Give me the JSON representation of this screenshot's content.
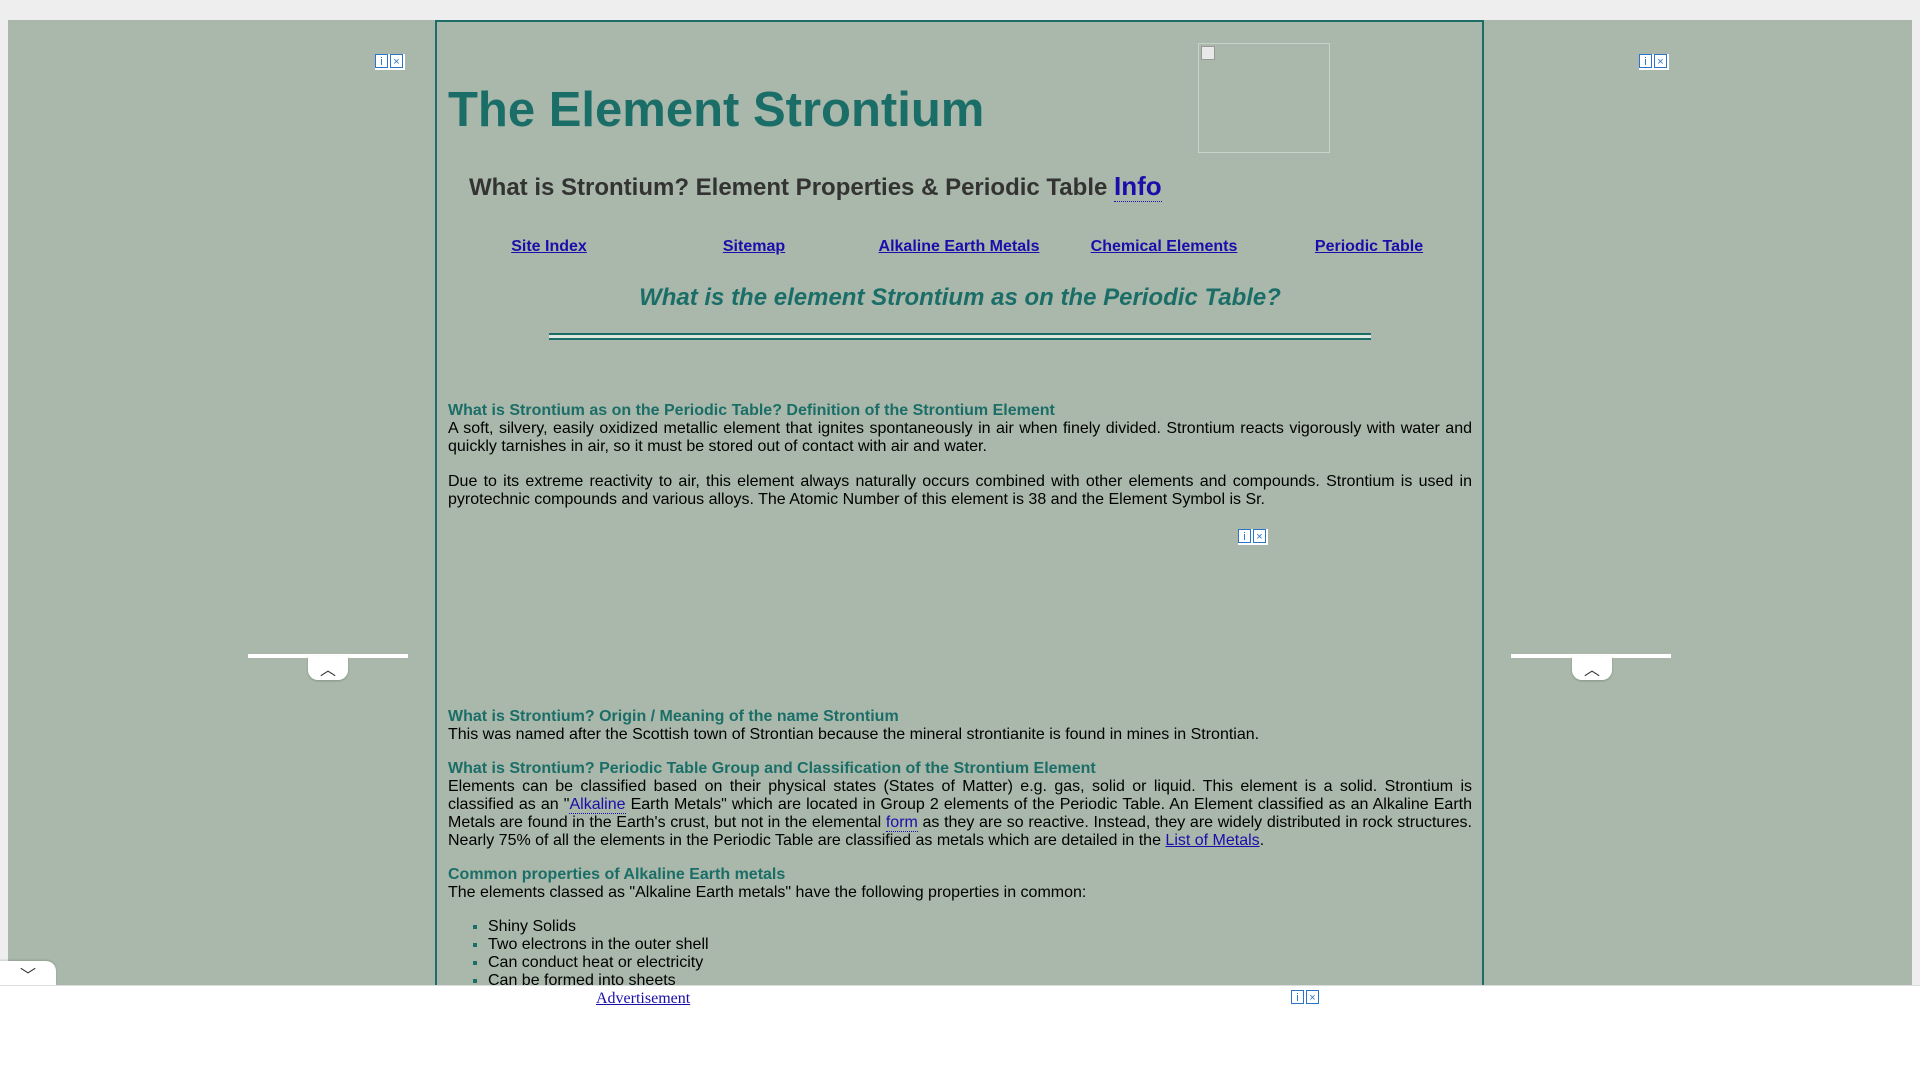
{
  "page": {
    "title": "The Element Strontium",
    "subtitle_text": "What is Strontium? Element Properties & Periodic Table ",
    "subtitle_link": "Info",
    "italic_heading": "What is the element Strontium as on the Periodic Table?"
  },
  "nav": {
    "site_index": "Site Index",
    "sitemap": "Sitemap",
    "alkaline_earth_metals": "Alkaline Earth Metals",
    "chemical_elements": "Chemical Elements",
    "periodic_table": "Periodic Table"
  },
  "definition": {
    "heading": "What is Strontium as on the Periodic Table? Definition of the Strontium Element",
    "p1": "A soft, silvery, easily oxidized metallic element that ignites spontaneously in air when finely divided. Strontium reacts vigorously with water and quickly tarnishes in air, so it must be stored out of contact with air and water.",
    "p2": "Due to its extreme reactivity to air, this element always naturally occurs combined with other elements and compounds. Strontium is used in pyrotechnic compounds and various alloys. The Atomic Number of this element is 38 and the Element Symbol is Sr."
  },
  "origin": {
    "heading": "What is Strontium? Origin / Meaning of the name Strontium",
    "text": "This was named after the Scottish town of Strontian because the mineral strontianite is found in mines in Strontian."
  },
  "classification": {
    "heading": "What is Strontium? Periodic Table Group and Classification of the Strontium Element",
    "t1": "Elements can be classified based on their physical states (States of Matter) e.g. gas, solid or liquid. This element is a solid. Strontium is classified as an \"",
    "link_alkaline": "Alkaline",
    "t2": " Earth Metals\" which are located in Group 2 elements of the Periodic Table. An Element classified as an Alkaline Earth Metals are found in the Earth's crust, but not in the elemental ",
    "link_form": "form",
    "t3": " as they are so reactive. Instead, they are widely distributed in rock structures. Nearly 75% of all the elements in the Periodic Table are classified as metals which are detailed in the ",
    "link_metals": "List of Metals",
    "t4": "."
  },
  "common": {
    "heading": "Common properties of Alkaline Earth metals",
    "intro": "The elements classed as \"Alkaline Earth metals\" have the following properties in common:",
    "items": [
      "Shiny Solids",
      "Two electrons in the outer shell",
      "Can conduct heat or electricity",
      "Can be formed into sheets"
    ]
  },
  "ads": {
    "info_glyph": "i",
    "close_glyph": "×",
    "up_glyph": "︿",
    "down_glyph": "﹀",
    "bottom_label": "Advertisement"
  }
}
